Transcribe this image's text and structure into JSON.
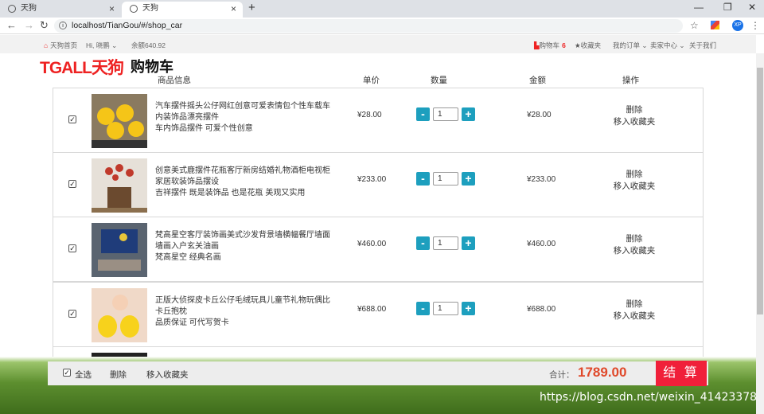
{
  "browser": {
    "tabs": [
      {
        "title": "天狗"
      },
      {
        "title": "天狗"
      }
    ],
    "url": "localhost/TianGou/#/shop_car",
    "profile": "XP"
  },
  "topbar": {
    "home": "天狗首页",
    "greeting": "Hi, 晓鹏",
    "balance": "余额640.92",
    "cart_label": "购物车",
    "cart_count": "6",
    "favorites": "收藏夹",
    "orders": "我的订单",
    "seller": "卖家中心",
    "about": "关于我们"
  },
  "header": {
    "logo": "TGALL天狗",
    "title": "购物车"
  },
  "columns": {
    "info": "商品信息",
    "unit_price": "单价",
    "quantity": "数量",
    "amount": "金额",
    "actions": "操作"
  },
  "items": [
    {
      "name": "汽车摆件摇头公仔网红创意可爱表情包个性车载车内装饰品漂亮摆件",
      "desc": "车内饰品摆件 可爱个性创意",
      "price": "¥28.00",
      "qty": "1",
      "amount": "¥28.00"
    },
    {
      "name": "创意美式鹿摆件花瓶客厅新房结婚礼物酒柜电视柜家居软装饰品摆设",
      "desc": "吉祥摆件 既是装饰品 也是花瓶 美观又实用",
      "price": "¥233.00",
      "qty": "1",
      "amount": "¥233.00"
    },
    {
      "name": "梵高星空客厅装饰画美式沙发背景墙横幅餐厅墙面墙画入户玄关油画",
      "desc": "梵高星空 经典名画",
      "price": "¥460.00",
      "qty": "1",
      "amount": "¥460.00"
    },
    {
      "name": "正版大侦探皮卡丘公仔毛绒玩具儿童节礼物玩偶比卡丘抱枕",
      "desc": "品质保证 可代写贺卡",
      "price": "¥688.00",
      "qty": "1",
      "amount": "¥688.00"
    }
  ],
  "actions": {
    "delete": "删除",
    "move_fav": "移入收藏夹"
  },
  "bottom": {
    "select_all": "全选",
    "delete": "删除",
    "move_fav": "移入收藏夹",
    "total_label": "合计：",
    "total": "1789.00",
    "checkout": "结 算"
  },
  "watermark": "https://blog.csdn.net/weixin_41423378"
}
